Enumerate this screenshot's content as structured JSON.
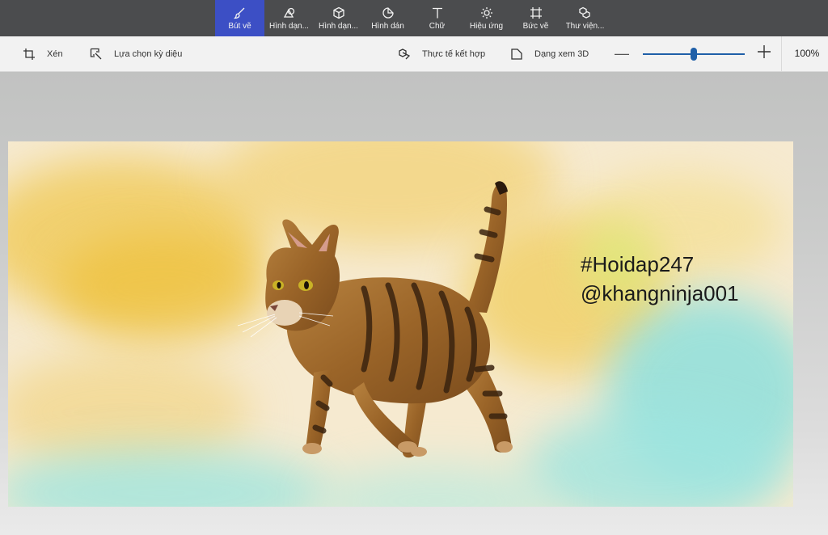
{
  "ribbon": {
    "tools": [
      {
        "label": "Bút vẽ",
        "icon": "brush-icon",
        "active": true
      },
      {
        "label": "Hình dạn...",
        "icon": "2d-shapes-icon",
        "active": false
      },
      {
        "label": "Hình dạn...",
        "icon": "3d-shapes-icon",
        "active": false
      },
      {
        "label": "Hình dán",
        "icon": "stickers-icon",
        "active": false
      },
      {
        "label": "Chữ",
        "icon": "text-icon",
        "active": false
      },
      {
        "label": "Hiệu ứng",
        "icon": "effects-icon",
        "active": false
      },
      {
        "label": "Bức vẽ",
        "icon": "canvas-icon",
        "active": false
      },
      {
        "label": "Thư viện...",
        "icon": "3d-library-icon",
        "active": false
      }
    ]
  },
  "toolbar": {
    "crop_label": "Xén",
    "magic_select_label": "Lựa chọn kỳ diệu",
    "mixed_reality_label": "Thực tế kết hợp",
    "view_3d_label": "Dạng xem 3D",
    "zoom_minus": "—",
    "zoom_value": "100%",
    "zoom_level": 0.5
  },
  "canvas": {
    "text_line1": "#Hoidap247",
    "text_line2": "@khangninja001",
    "accent_color": "#3c4fc5"
  }
}
